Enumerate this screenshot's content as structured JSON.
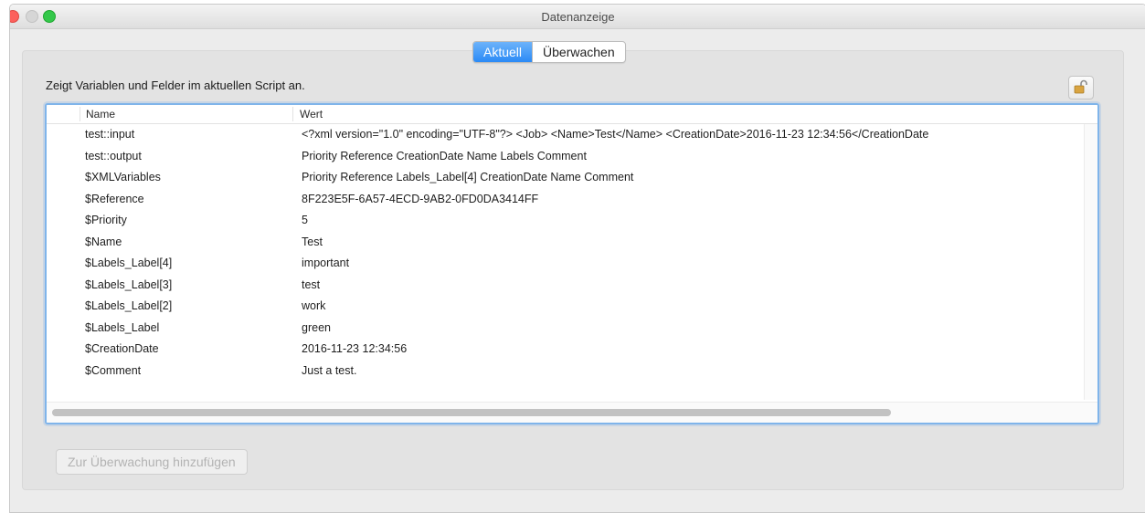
{
  "window": {
    "title": "Datenanzeige"
  },
  "tabs": [
    {
      "label": "Aktuell",
      "active": true
    },
    {
      "label": "Überwachen",
      "active": false
    }
  ],
  "hint": "Zeigt Variablen und Felder im aktuellen Script an.",
  "lock_button": {
    "icon": "lock-open-icon"
  },
  "table": {
    "columns": [
      "Name",
      "Wert"
    ],
    "rows": [
      {
        "name": "test::input",
        "value": "<?xml version=\"1.0\" encoding=\"UTF-8\"?> <Job>    <Name>Test</Name>    <CreationDate>2016-11-23 12:34:56</CreationDate"
      },
      {
        "name": "test::output",
        "value": "Priority Reference CreationDate Name Labels Comment"
      },
      {
        "name": "$XMLVariables",
        "value": "Priority Reference Labels_Label[4] CreationDate Name Comment"
      },
      {
        "name": "$Reference",
        "value": "8F223E5F-6A57-4ECD-9AB2-0FD0DA3414FF"
      },
      {
        "name": "$Priority",
        "value": "5"
      },
      {
        "name": "$Name",
        "value": "Test"
      },
      {
        "name": "$Labels_Label[4]",
        "value": "important"
      },
      {
        "name": "$Labels_Label[3]",
        "value": "test"
      },
      {
        "name": "$Labels_Label[2]",
        "value": "work"
      },
      {
        "name": "$Labels_Label",
        "value": "green"
      },
      {
        "name": "$CreationDate",
        "value": "2016-11-23 12:34:56"
      },
      {
        "name": "$Comment",
        "value": "Just a test."
      }
    ]
  },
  "add_button": {
    "label": "Zur Überwachung hinzufügen",
    "enabled": false
  },
  "colors": {
    "accent": "#2a8af6",
    "focus_ring": "#7fb4ea"
  }
}
